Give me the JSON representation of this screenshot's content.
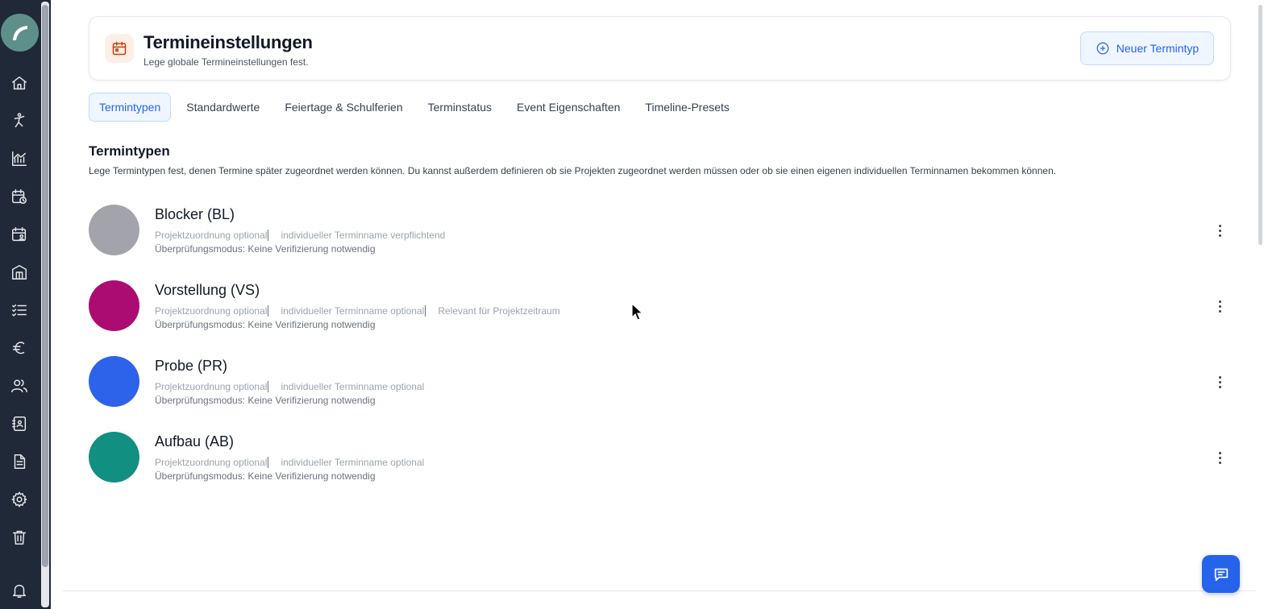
{
  "sidebar": {
    "icons": [
      "logo-icon",
      "home-icon",
      "dancer-icon",
      "chart-icon",
      "calendar-clock-icon",
      "calendar-user-icon",
      "building-icon",
      "checklist-icon",
      "euro-icon",
      "users-icon",
      "contacts-icon",
      "document-icon",
      "gear-icon",
      "trash-icon",
      "bell-icon"
    ]
  },
  "header": {
    "title": "Termineinstellungen",
    "subtitle": "Lege globale Termineinstellungen fest.",
    "new_button_label": "Neuer Termintyp"
  },
  "tabs": [
    {
      "label": "Termintypen",
      "active": true
    },
    {
      "label": "Standardwerte",
      "active": false
    },
    {
      "label": "Feiertage & Schulferien",
      "active": false
    },
    {
      "label": "Terminstatus",
      "active": false
    },
    {
      "label": "Event Eigenschaften",
      "active": false
    },
    {
      "label": "Timeline-Presets",
      "active": false
    }
  ],
  "section": {
    "title": "Termintypen",
    "description": "Lege Termintypen fest, denen Termine später zugeordnet werden können. Du kannst außerdem definieren ob sie Projekten zugeordnet werden müssen oder ob sie einen eigenen individuellen Terminnamen bekommen können."
  },
  "items": [
    {
      "name": "Blocker (BL)",
      "color": "#a3a3ab",
      "tags": [
        "Projektzuordnung optional",
        "individueller Terminname verpflichtend"
      ],
      "mode": "Überprüfungsmodus: Keine Verifizierung notwendig"
    },
    {
      "name": "Vorstellung (VS)",
      "color": "#ab0c72",
      "tags": [
        "Projektzuordnung optional",
        "individueller Terminname optional",
        "Relevant für Projektzeitraum"
      ],
      "mode": "Überprüfungsmodus: Keine Verifizierung notwendig"
    },
    {
      "name": "Probe (PR)",
      "color": "#2d62ea",
      "tags": [
        "Projektzuordnung optional",
        "individueller Terminname optional"
      ],
      "mode": "Überprüfungsmodus: Keine Verifizierung notwendig"
    },
    {
      "name": "Aufbau (AB)",
      "color": "#118f81",
      "tags": [
        "Projektzuordnung optional",
        "individueller Terminname optional"
      ],
      "mode": "Überprüfungsmodus: Keine Verifizierung notwendig"
    }
  ]
}
